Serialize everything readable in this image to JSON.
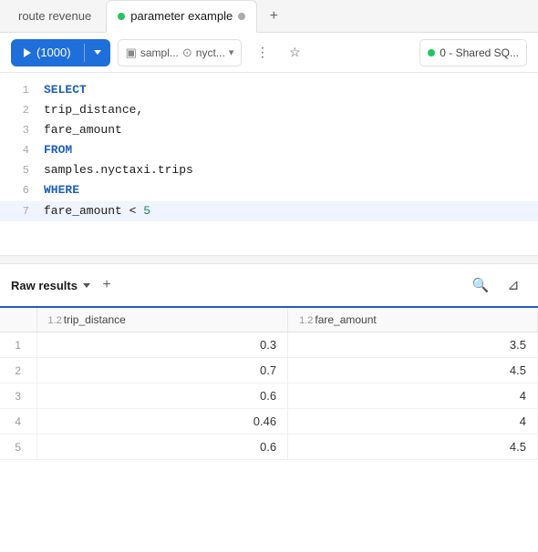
{
  "tabs": [
    {
      "id": "route-revenue",
      "label": "route revenue",
      "active": false,
      "hasIcon": false,
      "iconType": null
    },
    {
      "id": "parameter-example",
      "label": "parameter example",
      "active": true,
      "hasIcon": true,
      "iconType": "green"
    },
    {
      "id": "add",
      "label": "+",
      "active": false
    }
  ],
  "toolbar": {
    "run_label": "▶",
    "run_count": "(1000)",
    "db_display": "sampl... ⊙ nyct...",
    "db_label1": "sampl...",
    "db_label2": "nyct...",
    "status_text": "0 - Shared SQ..."
  },
  "code_lines": [
    {
      "num": "1",
      "tokens": [
        {
          "text": "SELECT",
          "class": "kw-select"
        }
      ],
      "highlighted": false
    },
    {
      "num": "2",
      "tokens": [
        {
          "text": "  trip_distance,",
          "class": ""
        }
      ],
      "highlighted": false
    },
    {
      "num": "3",
      "tokens": [
        {
          "text": "  fare_amount",
          "class": ""
        }
      ],
      "highlighted": false
    },
    {
      "num": "4",
      "tokens": [
        {
          "text": "FROM",
          "class": "kw-from"
        }
      ],
      "highlighted": false
    },
    {
      "num": "5",
      "tokens": [
        {
          "text": "  samples.nyctaxi.trips",
          "class": ""
        }
      ],
      "highlighted": false
    },
    {
      "num": "6",
      "tokens": [
        {
          "text": "WHERE",
          "class": "kw-where"
        }
      ],
      "highlighted": false
    },
    {
      "num": "7",
      "tokens": [
        {
          "text": "  fare_amount < ",
          "class": ""
        },
        {
          "text": "5",
          "class": "num-val"
        }
      ],
      "highlighted": true
    }
  ],
  "results": {
    "tab_label": "Raw results",
    "columns": [
      {
        "id": "row_num",
        "label": "",
        "type": ""
      },
      {
        "id": "trip_distance",
        "label": "trip_distance",
        "type": "1.2"
      },
      {
        "id": "fare_amount",
        "label": "fare_amount",
        "type": "1.2"
      }
    ],
    "rows": [
      {
        "num": "1",
        "trip_distance": "0.3",
        "fare_amount": "3.5"
      },
      {
        "num": "2",
        "trip_distance": "0.7",
        "fare_amount": "4.5"
      },
      {
        "num": "3",
        "trip_distance": "0.6",
        "fare_amount": "4"
      },
      {
        "num": "4",
        "trip_distance": "0.46",
        "fare_amount": "4"
      },
      {
        "num": "5",
        "trip_distance": "0.6",
        "fare_amount": "4.5"
      }
    ]
  },
  "icons": {
    "add": "+",
    "chevron_down": "▾",
    "search": "🔍",
    "filter": "⊿",
    "star": "☆",
    "dot_menu": "⋮",
    "cylinder": "⊙"
  }
}
